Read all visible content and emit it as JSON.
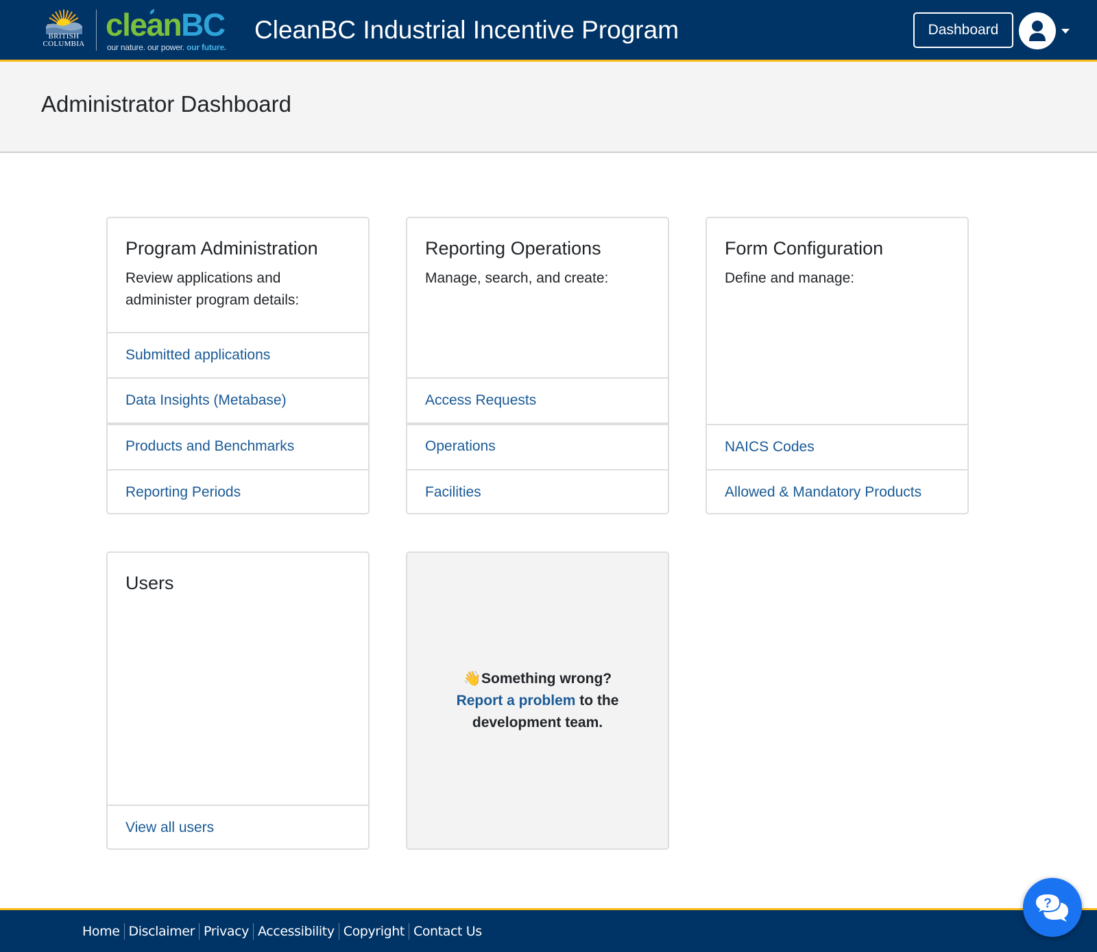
{
  "header": {
    "bc_logo_text_line1": "BRITISH",
    "bc_logo_text_line2": "COLUMBIA",
    "brand_clean": "clean",
    "brand_bc": "BC",
    "tagline_part1": "our nature. our power. ",
    "tagline_part2": "our future.",
    "app_title": "CleanBC Industrial Incentive Program",
    "dashboard_button": "Dashboard",
    "user_menu_icon": "user-circle-icon",
    "colors": {
      "header_bg": "#003366",
      "accent_gold": "#fcba19",
      "clean_green": "#7bbf3d",
      "bc_blue": "#2ea3d8"
    }
  },
  "page": {
    "title": "Administrator Dashboard"
  },
  "cards": [
    {
      "title": "Program Administration",
      "text": "Review applications and administer program details:",
      "links": [
        "Submitted applications",
        "Data Insights (Metabase)",
        "Products and Benchmarks",
        "Reporting Periods"
      ]
    },
    {
      "title": "Reporting Operations",
      "text": "Manage, search, and create:",
      "links": [
        "Access Requests",
        "Operations",
        "Facilities"
      ]
    },
    {
      "title": "Form Configuration",
      "text": "Define and manage:",
      "links": [
        "NAICS Codes",
        "Allowed & Mandatory Products"
      ]
    },
    {
      "title": "Users",
      "text": "",
      "links": [
        "View all users"
      ]
    }
  ],
  "report_problem": {
    "emoji": "👋",
    "line1": "Something wrong?",
    "link_text": "Report a problem",
    "line2_suffix": " to the",
    "line3": "development team."
  },
  "footer": {
    "links": [
      "Home",
      "Disclaimer",
      "Privacy",
      "Accessibility",
      "Copyright",
      "Contact Us"
    ]
  },
  "help_button": {
    "icon": "question-chat-bubbles-icon",
    "color": "#1a73f0"
  },
  "link_color": "#1a5a96"
}
